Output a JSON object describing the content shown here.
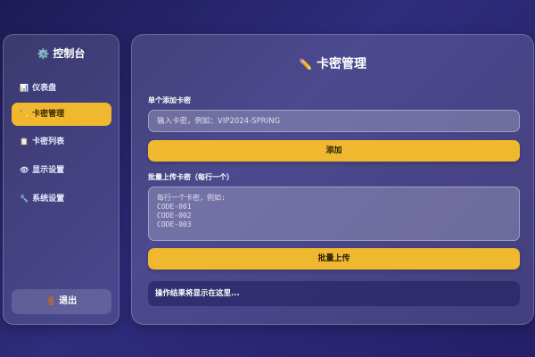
{
  "sidebar": {
    "title": "控制台",
    "title_icon": "⚙️",
    "items": [
      {
        "icon": "📊",
        "label": "仪表盘",
        "active": false
      },
      {
        "icon": "✏️",
        "label": "卡密管理",
        "active": true
      },
      {
        "icon": "📋",
        "label": "卡密列表",
        "active": false
      },
      {
        "icon": "👁",
        "label": "显示设置",
        "active": false
      },
      {
        "icon": "🔧",
        "label": "系统设置",
        "active": false
      }
    ],
    "logout": {
      "icon": "🚪",
      "label": "退出"
    }
  },
  "main": {
    "title": "卡密管理",
    "title_icon": "✏️",
    "single": {
      "label": "单个添加卡密",
      "placeholder": "输入卡密，例如：VIP2024-SPRING",
      "button": "添加"
    },
    "batch": {
      "label": "批量上传卡密（每行一个）",
      "placeholder": "每行一个卡密，例如:\nCODE-001\nCODE-002\nCODE-003",
      "button": "批量上传"
    },
    "result": "操作结果将显示在这里..."
  },
  "colors": {
    "accent": "#f0b82f",
    "background": "#2f2c7c"
  }
}
